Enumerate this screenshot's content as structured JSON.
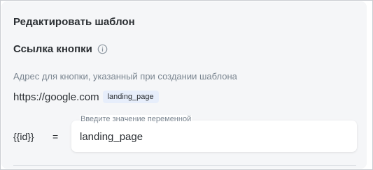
{
  "panel": {
    "title": "Редактировать шаблон"
  },
  "section": {
    "title": "Ссылка кнопки",
    "info_icon": "info-icon"
  },
  "description": "Адрес для кнопки, указанный при создании шаблона",
  "url": {
    "text": "https://google.com",
    "variable_badge": "landing_page"
  },
  "variable": {
    "name": "{{id}}",
    "equals": "=",
    "input_label": "Введите значение переменной",
    "input_value": "landing_page"
  },
  "colors": {
    "panel_bg": "#f5f6f8",
    "badge_bg": "#e7eefb",
    "text": "#2b2f33",
    "muted_text": "#7a8590"
  }
}
